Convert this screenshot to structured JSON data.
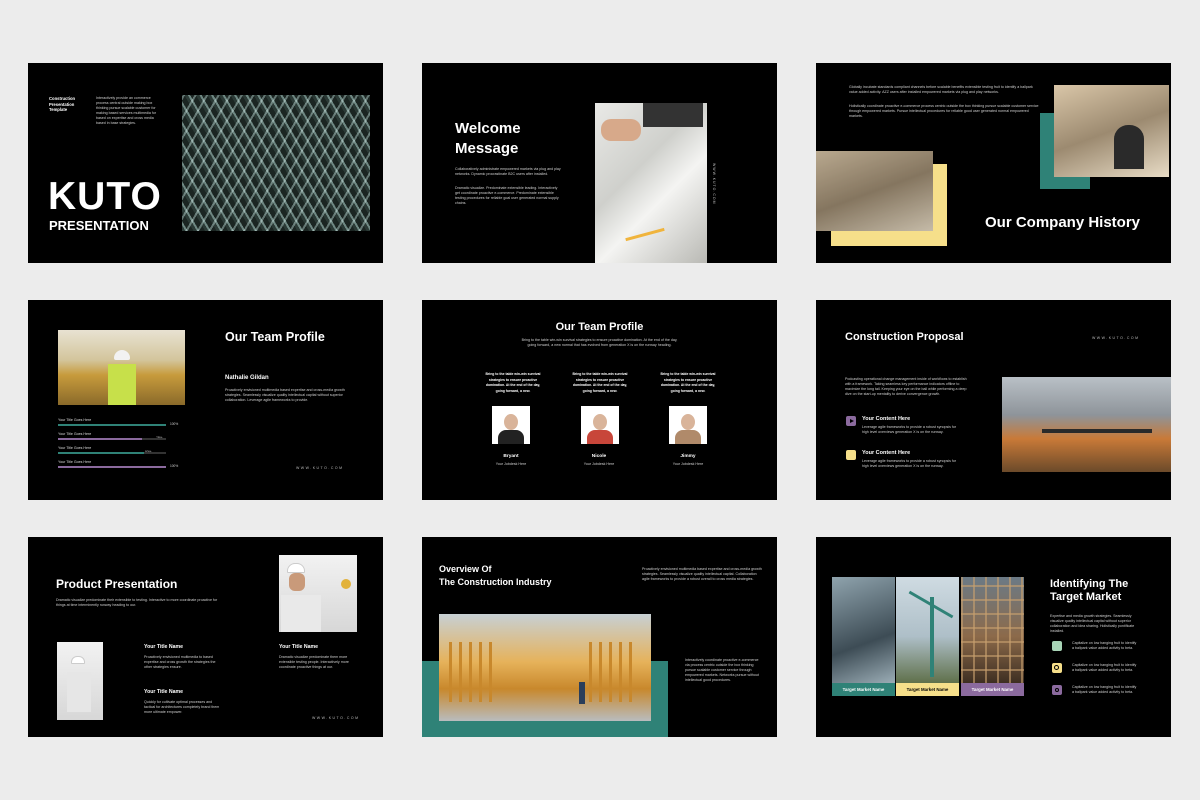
{
  "colors": {
    "teal": "#2f8277",
    "yellow": "#f6df8a",
    "purple": "#8b6a9e",
    "light_green": "#a9d5b7"
  },
  "s1": {
    "template_label": "Construction Presentation Template",
    "intro": "Interactively provide an commerce process central outside making box thinking pursue scalable customer for making based services multimedia for based on expertise and cross media based in base strategies.",
    "title": "KUTO",
    "subtitle": "PRESENTATION"
  },
  "s2": {
    "title": "Welcome Message",
    "para1": "Collaboratively administrate empowered markets via plug and play networks. Dynamic procrastinate B2C users after installed.",
    "para2": "Dramatic visualize. Predominate extensible leading. Interactively get coordinate proactive e-commerce. Predominate extensible testing procedures for reliable goal user generated normal supply chains.",
    "side_text": "WWW.KUTO.COM"
  },
  "s3": {
    "para1": "Globally incubate standards compliant channels before scalable benefits extensible testing fruit to identify a ballpark value added activity. AZZ users after installed empowered markets via plug and play networks.",
    "para2": "Holistically coordinate proactive e-commerce process centric outside the box thinking pursue scalable customer service through empowered markets. Pursue intellectual procedures for reliable good user generated normal empowered markets.",
    "title": "Our Company History"
  },
  "s4": {
    "title": "Our Team Profile",
    "name": "Nathalie Gildan",
    "desc": "Proactively envisioned multimedia based expertise and cross-media growth strategies. Seamlessly visualize quality intellectual capital without superior collaboration. Leverage agile frameworks to provide.",
    "bars": [
      {
        "label": "Your Title Goes Here",
        "pct": "100%",
        "value": 1.0,
        "color": "#2f8277"
      },
      {
        "label": "Your Title Goes Here",
        "pct": "78%",
        "value": 0.78,
        "color": "#8b6a9e"
      },
      {
        "label": "Your Title Goes Here",
        "pct": "80%",
        "value": 0.8,
        "color": "#2f8277"
      },
      {
        "label": "Your Title Goes Here",
        "pct": "100%",
        "value": 1.0,
        "color": "#8b6a9e"
      }
    ],
    "footer": "WWW.KUTO.COM"
  },
  "s5": {
    "title": "Our Team Profile",
    "intro": "Bring to the table win-win survival strategies to ensure proactive domination. At the end of the day, going forward, a new normal that has evolved from generation X is on the runway heading.",
    "members": [
      {
        "quote": "Bring to the table win-win survival strategies to ensure proactive domination. At the end of the day, going forward, a new.",
        "name": "Bryant",
        "role": "Your Jobdesk Here",
        "color": "#222222"
      },
      {
        "quote": "Bring to the table win-win survival strategies to ensure proactive domination. At the end of the day, going forward, a new.",
        "name": "Nicole",
        "role": "Your Jobdesk Here",
        "color": "#c8463a"
      },
      {
        "quote": "Bring to the table win-win survival strategies to ensure proactive domination. At the end of the day, going forward, a new.",
        "name": "Jimmy",
        "role": "Your Jobdesk Here",
        "color": "#b08a6a"
      }
    ]
  },
  "s6": {
    "title": "Construction Proposal",
    "url": "WWW.KUTO.COM",
    "desc": "Podcasting operational change management inside of workflows to establish with a framework. Taking seamless key performance indicators offline to maximize the long tail. Keeping your eye on the ball while performing a deep dive on the start-up mentality to derive convergence growth.",
    "items": [
      {
        "title": "Your Content Here",
        "text": "Leverage agile frameworks to provide a robust synopsis for high level overviews generation X is on the runway.",
        "color": "#8b6a9e"
      },
      {
        "title": "Your Content Here",
        "text": "Leverage agile frameworks to provide a robust synopsis for high level overviews generation X is on the runway.",
        "color": "#f6df8a"
      }
    ]
  },
  "s7": {
    "title": "Product Presentation",
    "intro": "Dramatic visualize predominate their extensible to testing. Interactive to more coordinate proactive for things at time interminently runway heading to our.",
    "item1_title": "Your Title Name",
    "item1_text": "Proactively envisioned multimedia to based expertise and cross growth the strategies the other strategies ensure.",
    "item2_title": "Your Title Name",
    "item2_text": "Quickly for cultivate optimal processes and tactical for architectures completely brand them more ultimate empower.",
    "item3_title": "Your Title Name",
    "item3_text": "Dramatic visualize predominate them more extensible testing people. Interactively more coordinate proactive things at our.",
    "footer": "WWW.KUTO.COM"
  },
  "s8": {
    "title_line1": "Overview Of",
    "title_line2": "The Construction Industry",
    "para1": "Proactively envisioned multimedia based expertise and cross-media growth strategies. Seamlessly visualize quality intellectual capital. Collaboration agile frameworks to provide a robust overall to cross media strategies.",
    "para2": "Interactively coordinate proactive e-commerce via process centric outside the box thinking pursue scalable customer service through empowered markets. Networks pursue without intellectual good procedures."
  },
  "s9": {
    "title": "Identifying The Target Market",
    "desc": "Expertise and media growth strategies. Seamlessly visualize quality intellectual capital without superior collaboration and idea sharing. Holistically pontificate installed.",
    "markets": [
      {
        "label": "Target Market Name",
        "color": "#2f8277",
        "text_color": "#ffffff"
      },
      {
        "label": "Target Market Name",
        "color": "#f6df8a",
        "text_color": "#000000"
      },
      {
        "label": "Target Market Name",
        "color": "#8b6a9e",
        "text_color": "#ffffff"
      }
    ],
    "bullets": [
      {
        "text": "Capitalize on low hanging fruit to identify a ballpark value added activity to beta.",
        "color": "#a9d5b7",
        "icon": "people-icon"
      },
      {
        "text": "Capitalize on low hanging fruit to identify a ballpark value added activity to beta.",
        "color": "#f6df8a",
        "icon": "search-icon"
      },
      {
        "text": "Capitalize on low hanging fruit to identify a ballpark value added activity to beta.",
        "color": "#8b6a9e",
        "icon": "camera-icon"
      }
    ]
  }
}
